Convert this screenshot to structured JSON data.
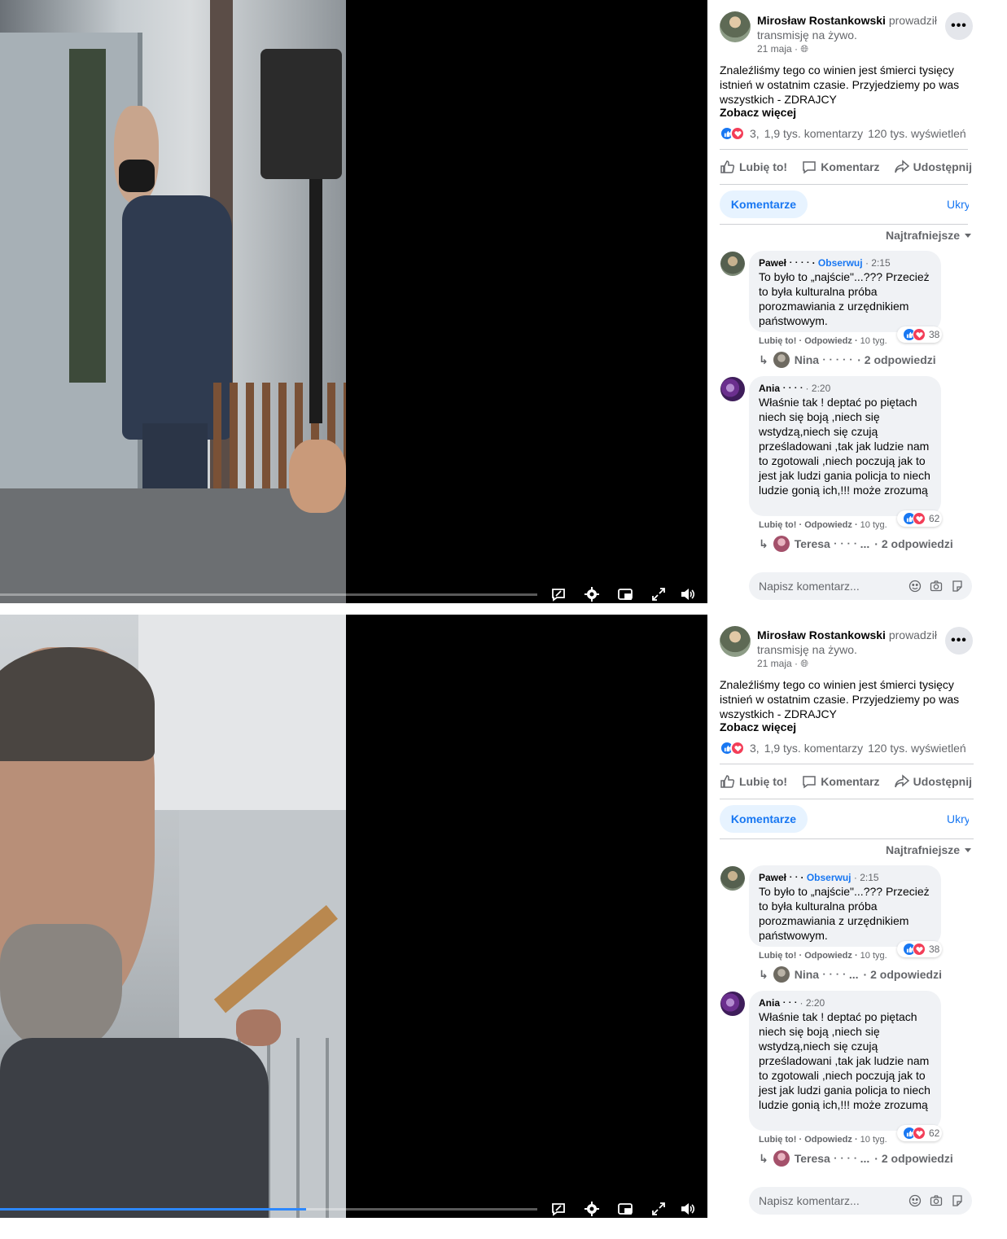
{
  "post": {
    "author_name": "Mirosław Rostankowski",
    "author_action": "prowadził transmisję na żywo.",
    "date": "21 maja ·",
    "text": "Znaleźliśmy tego co winien jest śmierci tysięcy istnień w ostatnim czasie. Przyjedziemy po was wszystkich - ZDRAJCY",
    "see_more": "Zobacz więcej",
    "reactions_count": "3,",
    "comments_count": "1,9 tys. komentarzy",
    "views_count": "120 tys. wyświetleń",
    "more_label": "•••"
  },
  "actions": {
    "like": "Lubię to!",
    "comment": "Komentarz",
    "share": "Udostępnij"
  },
  "comments_section": {
    "tab_label": "Komentarze",
    "hide_label": "Ukryj",
    "sort_label": "Najtrafniejsze",
    "composer_placeholder": "Napisz komentarz..."
  },
  "panels": [
    {
      "progress_percent": 0,
      "comments": [
        {
          "author": "Paweł ᐧ ᐧ ᐧ ᐧ",
          "follow": "Obserwuj",
          "time": "2:15",
          "text": "To było to „najście\"...??? Przecież to była kulturalna próba porozmawiania z urzędnikiem państwowym.",
          "like": "Lubię to!",
          "reply": "Odpowiedz",
          "ago": "10 tyg.",
          "reactions": "38",
          "reply_author": "Nina ᐧ ᐧ ᐧ ᐧ ᐧ",
          "replies_count": "2 odpowiedzi"
        },
        {
          "author": "Ania ᐧ ᐧ ᐧ ᐧ",
          "follow": "",
          "time": "2:20",
          "text": "Właśnie tak ! deptać po piętach niech się boją ,niech się wstydzą,niech się czują prześladowani ,tak jak ludzie nam to zgotowali ,niech poczują jak to jest jak ludzi gania policja to niech ludzie gonią ich,!!! może zrozumą",
          "like": "Lubię to!",
          "reply": "Odpowiedz",
          "ago": "10 tyg.",
          "reactions": "62",
          "reply_author": "Teresa ᐧ ᐧ ᐧ ᐧ ...",
          "replies_count": "2 odpowiedzi"
        }
      ]
    },
    {
      "progress_percent": 57,
      "comments": [
        {
          "author": "Paweł ᐧ ᐧ",
          "follow": "Obserwuj",
          "time": "2:15",
          "text": "To było to „najście\"...??? Przecież to była kulturalna próba porozmawiania z urzędnikiem państwowym.",
          "like": "Lubię to!",
          "reply": "Odpowiedz",
          "ago": "10 tyg.",
          "reactions": "38",
          "reply_author": "Nina ᐧ ᐧ ᐧ ᐧ ...",
          "replies_count": "2 odpowiedzi"
        },
        {
          "author": "Ania ᐧ ᐧ ᐧ",
          "follow": "",
          "time": "2:20",
          "text": "Właśnie tak ! deptać po piętach niech się boją ,niech się wstydzą,niech się czują prześladowani ,tak jak ludzie nam to zgotowali ,niech poczują jak to jest jak ludzi gania policja to niech ludzie gonią ich,!!! może zrozumą",
          "like": "Lubię to!",
          "reply": "Odpowiedz",
          "ago": "10 tyg.",
          "reactions": "62",
          "reply_author": "Teresa ᐧ ᐧ ᐧ ᐧ ...",
          "replies_count": "2 odpowiedzi"
        }
      ]
    }
  ],
  "colors": {
    "accent": "#1877f2",
    "like": "#1877f2",
    "love": "#f33e58",
    "progress": "#2d88ff"
  }
}
